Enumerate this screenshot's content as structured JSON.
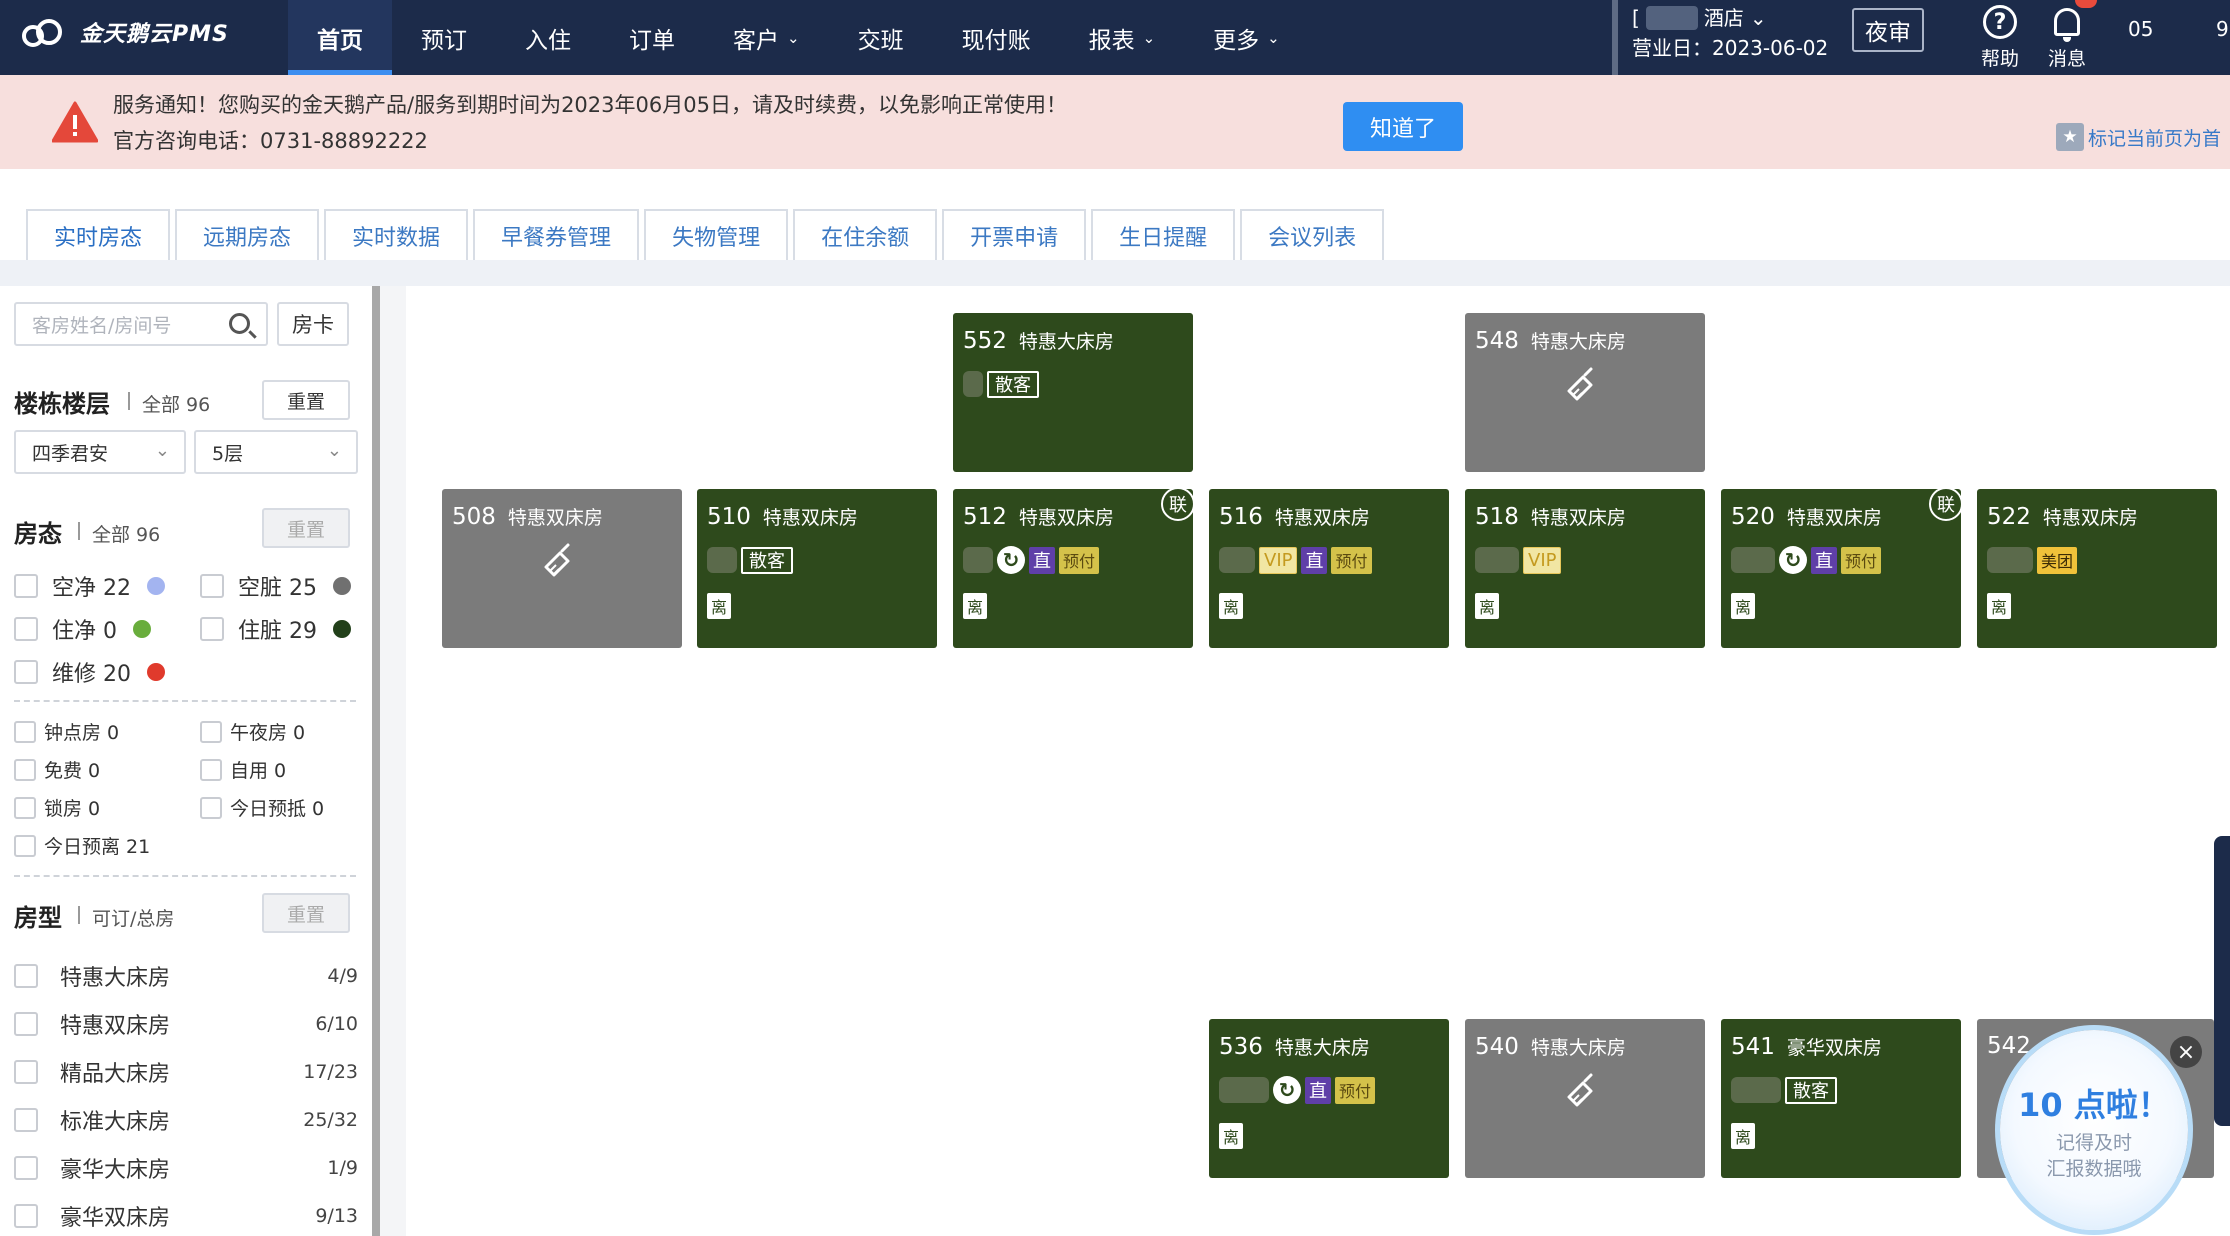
{
  "header": {
    "logo_text": "金天鹅云PMS",
    "nav": [
      {
        "label": "首页",
        "active": true,
        "dropdown": false
      },
      {
        "label": "预订",
        "active": false,
        "dropdown": false
      },
      {
        "label": "入住",
        "active": false,
        "dropdown": false
      },
      {
        "label": "订单",
        "active": false,
        "dropdown": false
      },
      {
        "label": "客户",
        "active": false,
        "dropdown": true
      },
      {
        "label": "交班",
        "active": false,
        "dropdown": false
      },
      {
        "label": "现付账",
        "active": false,
        "dropdown": false
      },
      {
        "label": "报表",
        "active": false,
        "dropdown": true
      },
      {
        "label": "更多",
        "active": false,
        "dropdown": true
      }
    ],
    "hotel_suffix": "酒店",
    "business_day": "营业日：2023-06-02",
    "night_audit": "夜审",
    "help": "帮助",
    "messages": "消息",
    "time_partial": "05",
    "time_partial2": "9"
  },
  "notice": {
    "line1": "服务通知！您购买的金天鹅产品/服务到期时间为2023年06月05日，请及时续费，以免影响正常使用！",
    "line2": "官方咨询电话：0731-88892222",
    "button": "知道了",
    "bookmark": "标记当前页为首"
  },
  "tabs": [
    "实时房态",
    "远期房态",
    "实时数据",
    "早餐券管理",
    "失物管理",
    "在住余额",
    "开票申请",
    "生日提醒",
    "会议列表"
  ],
  "sidebar": {
    "search_placeholder": "客房姓名/房间号",
    "card_button": "房卡",
    "building": {
      "title": "楼栋楼层",
      "total": "全部 96",
      "reset": "重置",
      "building_value": "四季君安",
      "floor_value": "5层"
    },
    "status": {
      "title": "房态",
      "total": "全部 96",
      "reset": "重置",
      "items": [
        {
          "label": "空净 22",
          "color": "#a3b4f0"
        },
        {
          "label": "空脏 25",
          "color": "#707070"
        },
        {
          "label": "住净 0",
          "color": "#69ad3c"
        },
        {
          "label": "住脏 29",
          "color": "#22401a"
        },
        {
          "label": "维修 20",
          "color": "#e03a2c"
        }
      ],
      "extras": [
        "钟点房 0",
        "午夜房 0",
        "免费 0",
        "自用 0",
        "锁房 0",
        "今日预抵 0",
        "今日预离 21"
      ]
    },
    "room_types": {
      "title": "房型",
      "sub": "可订/总房",
      "reset": "重置",
      "items": [
        {
          "name": "特惠大床房",
          "count": "4/9"
        },
        {
          "name": "特惠双床房",
          "count": "6/10"
        },
        {
          "name": "精品大床房",
          "count": "17/23"
        },
        {
          "name": "标准大床房",
          "count": "25/32"
        },
        {
          "name": "豪华大床房",
          "count": "1/9"
        },
        {
          "name": "豪华双床房",
          "count": "9/13"
        }
      ]
    }
  },
  "rooms": [
    {
      "number": "552",
      "type": "特惠大床房",
      "state": "occupied",
      "tags": [
        "散客"
      ],
      "leave": false,
      "link": false
    },
    {
      "number": "548",
      "type": "特惠大床房",
      "state": "vacant-dirty",
      "tags": [],
      "leave": false,
      "link": false
    },
    {
      "number": "508",
      "type": "特惠双床房",
      "state": "vacant-dirty",
      "tags": [],
      "leave": false,
      "link": false
    },
    {
      "number": "510",
      "type": "特惠双床房",
      "state": "occupied",
      "tags": [
        "散客"
      ],
      "leave": true,
      "link": false
    },
    {
      "number": "512",
      "type": "特惠双床房",
      "state": "occupied",
      "tags": [
        "直",
        "预付"
      ],
      "leave": true,
      "link": true
    },
    {
      "number": "516",
      "type": "特惠双床房",
      "state": "occupied",
      "tags": [
        "VIP",
        "直",
        "预付"
      ],
      "leave": true,
      "link": false
    },
    {
      "number": "518",
      "type": "特惠双床房",
      "state": "occupied",
      "tags": [
        "VIP"
      ],
      "leave": true,
      "link": false
    },
    {
      "number": "520",
      "type": "特惠双床房",
      "state": "occupied",
      "tags": [
        "直",
        "预付"
      ],
      "leave": true,
      "link": true
    },
    {
      "number": "522",
      "type": "特惠双床房",
      "state": "occupied",
      "tags": [
        "美团"
      ],
      "leave": true,
      "link": false
    },
    {
      "number": "536",
      "type": "特惠大床房",
      "state": "occupied",
      "tags": [
        "直",
        "预付"
      ],
      "leave": true,
      "link": false
    },
    {
      "number": "540",
      "type": "特惠大床房",
      "state": "vacant-dirty",
      "tags": [],
      "leave": false,
      "link": false
    },
    {
      "number": "541",
      "type": "豪华双床房",
      "state": "occupied",
      "tags": [
        "散客"
      ],
      "leave": true,
      "link": false
    },
    {
      "number": "542",
      "type": "",
      "state": "occupied-partial",
      "tags": [],
      "leave": false,
      "link": false
    }
  ],
  "labels": {
    "link": "联",
    "leave": "离"
  },
  "popup": {
    "title": "10 点啦！",
    "line1": "记得及时",
    "line2": "汇报数据哦"
  }
}
